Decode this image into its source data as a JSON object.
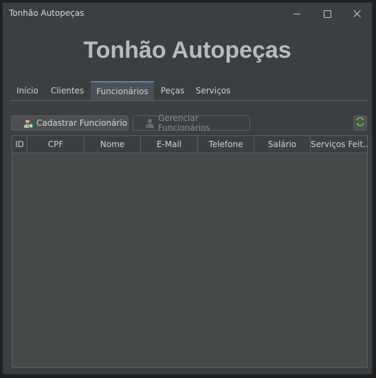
{
  "window": {
    "title": "Tonhão Autopeças"
  },
  "heading": "Tonhão Autopeças",
  "tabs": [
    {
      "label": "Início"
    },
    {
      "label": "Clientes"
    },
    {
      "label": "Funcionários",
      "active": true
    },
    {
      "label": "Peças"
    },
    {
      "label": "Serviços"
    }
  ],
  "toolbar": {
    "register_label": "Cadastrar Funcionário",
    "manage_label": "Gerenciar Funcionários",
    "refresh_icon": "refresh-icon"
  },
  "table": {
    "columns": [
      "ID",
      "CPF",
      "Nome",
      "E-Mail",
      "Telefone",
      "Salário",
      "Serviços Feit..."
    ],
    "rows": []
  },
  "colors": {
    "accent": "#4a88c7",
    "background": "#3c3f41",
    "refresh": "#5fba3a"
  }
}
